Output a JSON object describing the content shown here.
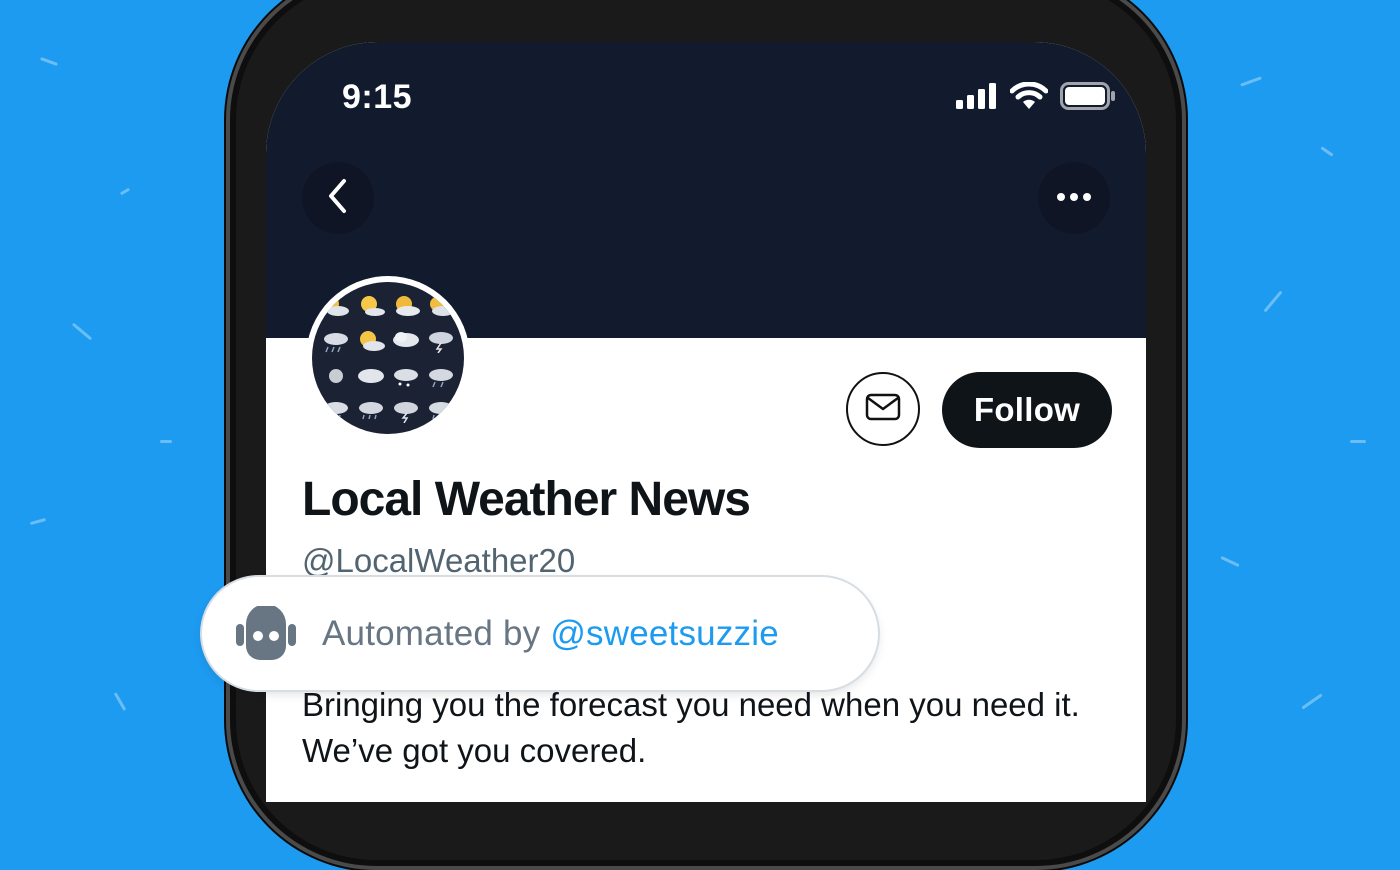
{
  "status_bar": {
    "time": "9:15",
    "icons": [
      "cellular-signal-icon",
      "wifi-icon",
      "battery-icon"
    ]
  },
  "nav": {
    "back_icon": "chevron-left-icon",
    "more_icon": "more-horizontal-icon"
  },
  "profile": {
    "name": "Local Weather News",
    "handle": "@LocalWeather20",
    "bio": "Bringing you the forecast you need when you need it.  We’ve got you covered.",
    "avatar_icon": "weather-icons-grid"
  },
  "actions": {
    "message_icon": "envelope-icon",
    "follow_label": "Follow"
  },
  "automated_label": {
    "icon": "robot-icon",
    "prefix": "Automated by",
    "link": "@sweetsuzzie"
  },
  "colors": {
    "background": "#1d9bf0",
    "banner": "#121b2e",
    "follow_button": "#0f1419",
    "link": "#1d9bf0",
    "secondary_text": "#536471"
  }
}
